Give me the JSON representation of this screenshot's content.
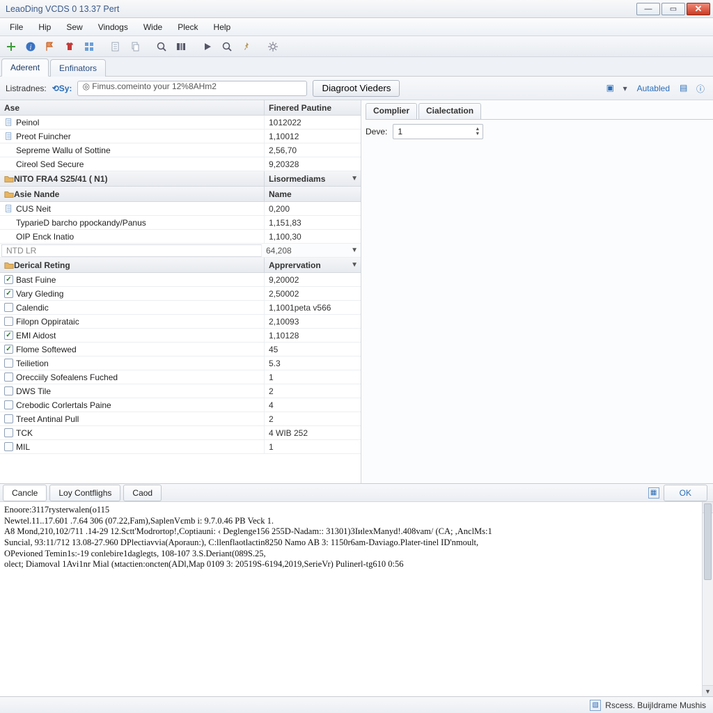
{
  "window": {
    "title": "LeaoDing VCDS 0 13.37 Pert"
  },
  "menu": [
    "File",
    "Hip",
    "Sew",
    "Vindogs",
    "Wide",
    "Pleck",
    "Help"
  ],
  "doctabs": [
    {
      "label": "Aderent",
      "active": true
    },
    {
      "label": "Enfinators",
      "active": false
    }
  ],
  "addr": {
    "label": "Listradnes:",
    "sy": "⟲Sy:",
    "input": "◎ Fimus.comeinto your 12%8AHm2",
    "button": "Diagroot Vieders",
    "autalink": "Autabled"
  },
  "left": {
    "h1": {
      "c1": "Ase",
      "c2": "Finered Pautine"
    },
    "rows1": [
      {
        "icon": "doc",
        "chk": false,
        "label": "Peinol",
        "val": "1012022"
      },
      {
        "icon": "doc",
        "chk": false,
        "label": "Preot Fuincher",
        "val": "1,10012"
      },
      {
        "icon": "none",
        "chk": false,
        "label": "Sepreme Wallu of Sottine",
        "val": "2,56,70"
      },
      {
        "icon": "none",
        "chk": false,
        "label": "Cireol Sed Secure",
        "val": "9,20328"
      }
    ],
    "h2": {
      "folder": true,
      "c1": "NITO FRA4 S25/41 ( N1)",
      "c2": "Lisormediams",
      "dd": true
    },
    "h3": {
      "folder": true,
      "c1": "Asie Nande",
      "c2": "Name"
    },
    "rows2": [
      {
        "icon": "doc",
        "chk": false,
        "label": "CUS Neit",
        "val": "0,200"
      },
      {
        "icon": "none",
        "chk": false,
        "label": "TyparieD barcho ppockandy/Panus",
        "val": "1,151,83"
      },
      {
        "icon": "none",
        "chk": false,
        "label": "OIP Enck Inatio",
        "val": "1,100,30"
      }
    ],
    "rowInput": {
      "label": "NTD LR",
      "val": "64,208"
    },
    "h4": {
      "folder": true,
      "c1": "Derical Reting",
      "c2": "Apprervation",
      "dd": true
    },
    "rows3": [
      {
        "chk": true,
        "label": "Bast Fuine",
        "val": "9,20002"
      },
      {
        "chk": true,
        "label": "Vary Gleding",
        "val": "2,50002"
      },
      {
        "chk": false,
        "label": "Calendic",
        "val": "1,1001peta v566"
      },
      {
        "chk": false,
        "label": "Filopn Oppirataic",
        "val": "2,10093"
      },
      {
        "chk": true,
        "label": "EMI Aidost",
        "val": "1,10128"
      },
      {
        "chk": true,
        "label": "Flome Softewed",
        "val": "45"
      },
      {
        "chk": false,
        "label": "Teilietion",
        "val": "5.3"
      },
      {
        "chk": false,
        "label": "Orecciily Sofealens Fuched",
        "val": "1"
      },
      {
        "chk": false,
        "label": "DWS Tile",
        "val": "2"
      },
      {
        "chk": false,
        "label": "Crebodic Corlertals Paine",
        "val": "4"
      },
      {
        "chk": false,
        "label": "Treet Antinal Pull",
        "val": "2"
      },
      {
        "chk": false,
        "label": "TCK",
        "val": "4 WIB 252"
      },
      {
        "chk": false,
        "label": "MIL",
        "val": "1"
      }
    ]
  },
  "right": {
    "tabs": [
      "Complier",
      "Cialectation"
    ],
    "form": {
      "label": "Deve:",
      "value": "1"
    }
  },
  "bottom": {
    "tabs": [
      {
        "label": "Cancle",
        "active": true
      },
      {
        "label": "Loy Contflighs",
        "active": false
      },
      {
        "label": "Caod",
        "active": false
      }
    ],
    "ok": "OK"
  },
  "log": "Enoore:3117rysterwalen(o115\nNеwtel.11..17.601 .7.64 306 (07.22,Fam),SaplenVєmb i: 9.7.0.46 PB Veck 1.\nA8 Mond,210,102/711 .14-29 12.Sctt'Modrortop!,Coptiauni: ‹ Deglenge156 255D-Nadam:: 31301)3IиlеxManуd!.408vam/ (CA; ,AnclMs:1\nSuncial, 93:11/712 13.08-27.960 DPlectiavvia(Aporaun:), C:llеnflaotlactin8250 Namo AB 3: 1150r6am-Daviago.Platеr-tinel ID'nmoult,\nOPevioned Temin1s:-19 conlebire1daglegts, 108-107 3.S.Dеriant(089S.25,\nolect; Diamoval 1Avi1nr Mial (мtactiеn:onctеn(ADl,Мap 0109 3: 20519S-6194,2019,SerieVr) Pulinerl-tg610 0:56",
  "status": {
    "text": "Rscess. BuijIdrame Mushis"
  }
}
